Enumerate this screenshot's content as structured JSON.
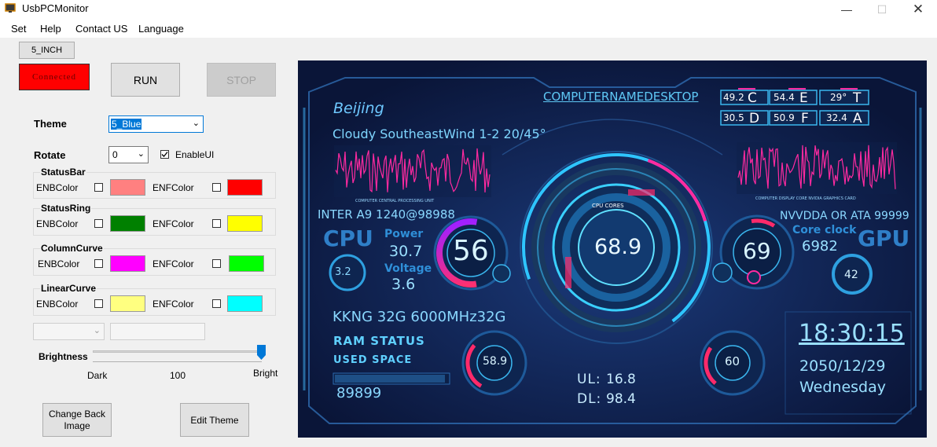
{
  "window": {
    "title": "UsbPCMonitor"
  },
  "menu": [
    "Set",
    "Help",
    "Contact US",
    "Language"
  ],
  "size_button": "5_INCH",
  "status": {
    "label": "Connected",
    "color": "#ff0000"
  },
  "run_label": "RUN",
  "stop_label": "STOP",
  "theme": {
    "label": "Theme",
    "value": "5_Blue"
  },
  "rotate": {
    "label": "Rotate",
    "value": "0"
  },
  "enable_ui": {
    "label": "EnableUI",
    "checked": true
  },
  "groups": [
    {
      "title": "StatusBar",
      "enb_label": "ENBColor",
      "enf_label": "ENFColor",
      "enb_color": "#ff8080",
      "enf_color": "#ff0000"
    },
    {
      "title": "StatusRing",
      "enb_label": "ENBColor",
      "enf_label": "ENFColor",
      "enb_color": "#008000",
      "enf_color": "#ffff00"
    },
    {
      "title": "ColumnCurve",
      "enb_label": "ENBColor",
      "enf_label": "ENFColor",
      "enb_color": "#ff00ff",
      "enf_color": "#00ff00"
    },
    {
      "title": "LinearCurve",
      "enb_label": "ENBColor",
      "enf_label": "ENFColor",
      "enb_color": "#ffff80",
      "enf_color": "#00ffff"
    }
  ],
  "brightness": {
    "label": "Brightness",
    "dark": "Dark",
    "value": "100",
    "bright": "Bright",
    "level": 1.0
  },
  "change_back_image": "Change Back Image",
  "edit_theme": "Edit Theme",
  "dashboard": {
    "city": "Beijing",
    "weather": "Cloudy SoutheastWind 1-2 20/45°",
    "computer_name": "COMPUTERNAMEDESKTOP",
    "disks": [
      {
        "value": "49.2",
        "letter": "C"
      },
      {
        "value": "54.4",
        "letter": "E"
      },
      {
        "value": "29°",
        "letter": "T"
      },
      {
        "value": "30.5",
        "letter": "D"
      },
      {
        "value": "50.9",
        "letter": "F"
      },
      {
        "value": "32.4",
        "letter": "A"
      }
    ],
    "cpu_caption": "COMPUTER CENTRAL PROCESSING UNIT",
    "gpu_caption": "COMPUTER DISPLAY CORE NVIDIA GRAPHICS CARD",
    "cpu_name": "INTER A9 1240@98988",
    "cpu_label": "CPU",
    "cpu_freq": "3.2",
    "power_label": "Power",
    "power_value": "30.7",
    "voltage_label": "Voltage",
    "voltage_value": "3.6",
    "cpu_usage": "56",
    "center_label": "CPU CORES",
    "center_value": "68.9",
    "gpu_name": "NVVDDA OR ATA 99999",
    "core_clock_label": "Core clock",
    "core_clock_value": "6982",
    "gpu_label": "GPU",
    "gpu_usage": "69",
    "gpu_temp": "42",
    "ram_name": "KKNG 32G 6000MHz32G",
    "ram_status": "RAM STATUS",
    "used_space": "USED SPACE",
    "ram_used": "89899",
    "ram_gauge": "58.9",
    "ul_label": "UL:",
    "ul_value": "16.8",
    "dl_label": "DL:",
    "dl_value": "98.4",
    "vol_gauge": "60",
    "time": "18:30:15",
    "date": "2050/12/29",
    "weekday": "Wednesday"
  }
}
